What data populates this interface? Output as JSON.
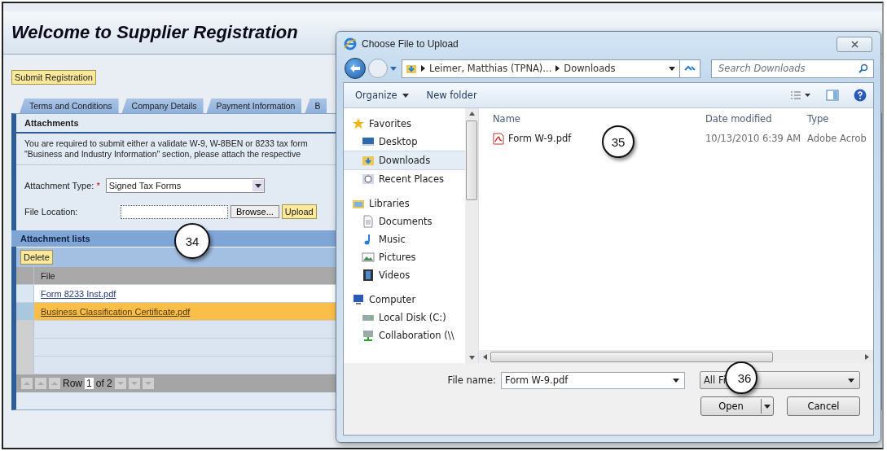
{
  "page": {
    "title": "Welcome to Supplier Registration",
    "submit_button": "Submit Registration",
    "tabs": [
      {
        "label": "Terms and Conditions"
      },
      {
        "label": "Company Details"
      },
      {
        "label": "Payment Information"
      },
      {
        "label": "B"
      }
    ],
    "section_title": "Attachments",
    "instructions": [
      "You are required to submit either a validate W-9, W-8BEN or 8233 tax form",
      "\"Business and Industry Information\" section, please attach the respective"
    ],
    "attachment_type": {
      "label": "Attachment Type:",
      "required_mark": "*",
      "value": "Signed Tax Forms"
    },
    "file_location": {
      "label": "File Location:",
      "browse": "Browse...",
      "upload": "Upload"
    },
    "attachment_list": {
      "title": "Attachment lists",
      "delete": "Delete",
      "column": "File",
      "rows": [
        {
          "file": "Form 8233 Inst.pdf",
          "selected": false
        },
        {
          "file": "Business Classification Certificate.pdf",
          "selected": true
        }
      ],
      "pager": {
        "label": "Row",
        "value": "1",
        "total": "of 2"
      }
    }
  },
  "dialog": {
    "title": "Choose File to Upload",
    "breadcrumb": [
      "Leimer, Matthias (TPNA)...",
      "Downloads"
    ],
    "search": {
      "placeholder": "Search Downloads"
    },
    "toolbar": [
      "Organize",
      "New folder"
    ],
    "nav": [
      {
        "label": "Favorites",
        "children": [
          {
            "label": "Desktop",
            "selected": false
          },
          {
            "label": "Downloads",
            "selected": true
          },
          {
            "label": "Recent Places",
            "selected": false
          }
        ]
      },
      {
        "label": "Libraries",
        "children": [
          {
            "label": "Documents",
            "selected": false
          },
          {
            "label": "Music",
            "selected": false
          },
          {
            "label": "Pictures",
            "selected": false
          },
          {
            "label": "Videos",
            "selected": false
          }
        ]
      },
      {
        "label": "Computer",
        "children": [
          {
            "label": "Local Disk (C:)",
            "selected": false
          },
          {
            "label": "Collaboration (\\\\",
            "selected": false
          }
        ]
      }
    ],
    "columns": [
      "Name",
      "Date modified",
      "Type"
    ],
    "files": [
      {
        "name": "Form W-9.pdf",
        "date": "10/13/2010 6:39 AM",
        "type": "Adobe Acrob"
      }
    ],
    "file_name": {
      "label": "File name:",
      "value": "Form W-9.pdf"
    },
    "file_type": "All Fi",
    "buttons": [
      "Open",
      "Cancel"
    ]
  },
  "callouts": [
    "34",
    "35",
    "36"
  ]
}
